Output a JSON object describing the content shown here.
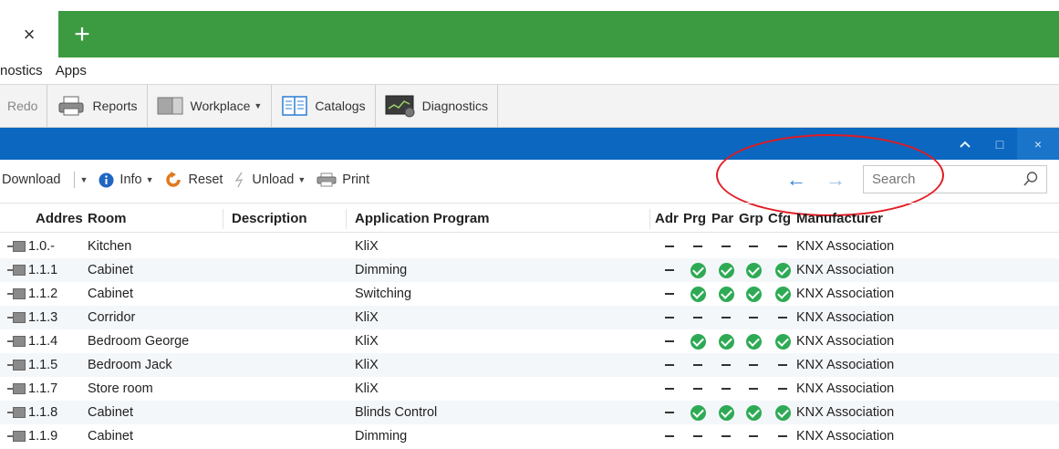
{
  "tabs": {
    "close_glyph": "×",
    "add_glyph": "+"
  },
  "menu": {
    "items": [
      "nostics",
      "Apps"
    ]
  },
  "toolbar": {
    "redo_label": "Redo",
    "reports_label": "Reports",
    "workplace_label": "Workplace",
    "catalogs_label": "Catalogs",
    "diagnostics_label": "Diagnostics"
  },
  "panel": {
    "collapse_glyph": "^",
    "maximize_glyph": "□",
    "close_glyph": "×"
  },
  "commands": {
    "download_label": "Download",
    "info_label": "Info",
    "reset_label": "Reset",
    "unload_label": "Unload",
    "print_label": "Print"
  },
  "nav": {
    "back_glyph": "←",
    "forward_glyph": "→"
  },
  "search": {
    "placeholder": "Search"
  },
  "columns": {
    "address": "Addres",
    "room": "Room",
    "description": "Description",
    "application": "Application Program",
    "adr": "Adr",
    "prg": "Prg",
    "par": "Par",
    "grp": "Grp",
    "cfg": "Cfg",
    "manufacturer": "Manufacturer"
  },
  "devices": [
    {
      "address": "1.0.-",
      "room": "Kitchen",
      "description": "",
      "application": "KliX",
      "status": [
        "dash",
        "dash",
        "dash",
        "dash",
        "dash"
      ],
      "manufacturer": "KNX Association"
    },
    {
      "address": "1.1.1",
      "room": "Cabinet",
      "description": "",
      "application": "Dimming",
      "status": [
        "dash",
        "ok",
        "ok",
        "ok",
        "ok"
      ],
      "manufacturer": "KNX Association"
    },
    {
      "address": "1.1.2",
      "room": "Cabinet",
      "description": "",
      "application": "Switching",
      "status": [
        "dash",
        "ok",
        "ok",
        "ok",
        "ok"
      ],
      "manufacturer": "KNX Association"
    },
    {
      "address": "1.1.3",
      "room": "Corridor",
      "description": "",
      "application": "KliX",
      "status": [
        "dash",
        "dash",
        "dash",
        "dash",
        "dash"
      ],
      "manufacturer": "KNX Association"
    },
    {
      "address": "1.1.4",
      "room": "Bedroom George",
      "description": "",
      "application": "KliX",
      "status": [
        "dash",
        "ok",
        "ok",
        "ok",
        "ok"
      ],
      "manufacturer": "KNX Association"
    },
    {
      "address": "1.1.5",
      "room": "Bedroom Jack",
      "description": "",
      "application": "KliX",
      "status": [
        "dash",
        "dash",
        "dash",
        "dash",
        "dash"
      ],
      "manufacturer": "KNX Association"
    },
    {
      "address": "1.1.7",
      "room": "Store room",
      "description": "",
      "application": "KliX",
      "status": [
        "dash",
        "dash",
        "dash",
        "dash",
        "dash"
      ],
      "manufacturer": "KNX Association"
    },
    {
      "address": "1.1.8",
      "room": "Cabinet",
      "description": "",
      "application": "Blinds Control",
      "status": [
        "dash",
        "ok",
        "ok",
        "ok",
        "ok"
      ],
      "manufacturer": "KNX Association"
    },
    {
      "address": "1.1.9",
      "room": "Cabinet",
      "description": "",
      "application": "Dimming",
      "status": [
        "dash",
        "dash",
        "dash",
        "dash",
        "dash"
      ],
      "manufacturer": "KNX Association"
    }
  ],
  "colors": {
    "tab_strip": "#3c9b41",
    "panel_header": "#0b67bf",
    "status_ok": "#2eaa55",
    "annotation": "#e31b23",
    "nav_arrow": "#2b7fd4"
  },
  "icons": {
    "close_tab": "close-icon",
    "new_tab": "plus-icon",
    "reports": "printer-icon",
    "workplace": "workplace-icon",
    "catalogs": "catalog-icon",
    "diagnostics": "diagnostics-monitor-icon",
    "info": "info-icon",
    "reset": "reset-icon",
    "unload": "unload-bolt-icon",
    "print": "printer-icon",
    "search": "magnifier-icon",
    "device": "device-icon"
  }
}
